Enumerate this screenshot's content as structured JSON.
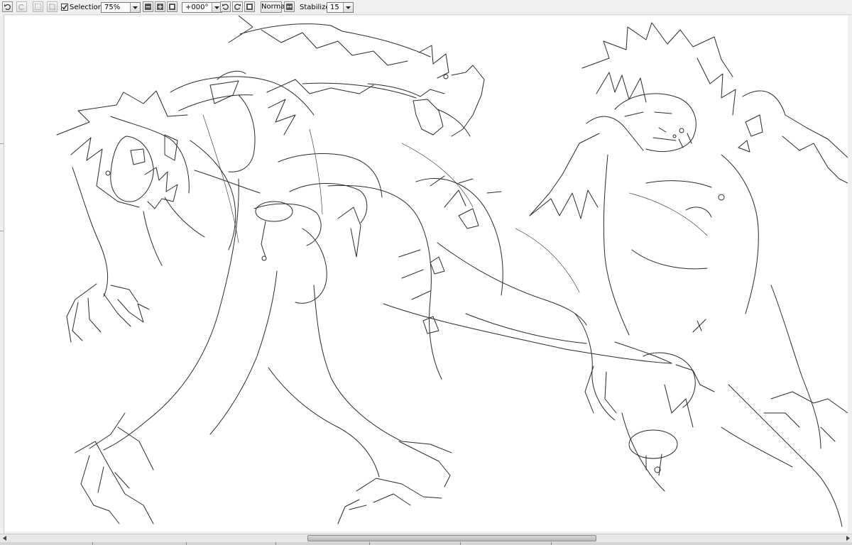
{
  "toolbar": {
    "undo_icon": "undo-icon",
    "redo_icon": "redo-icon",
    "selection_label": "Selection",
    "selection_checked": true,
    "zoom_value": "75%",
    "rotation_value": "+000°",
    "blend_mode_label": "Normal",
    "stabilizer_label": "Stabilizer",
    "stabilizer_value": "15"
  },
  "canvas": {
    "background_color": "#ffffff",
    "content": "sketch-lineart"
  },
  "scrollbar": {
    "left_arrow_icon": "arrow-left-icon",
    "right_arrow_icon": "arrow-right-icon"
  },
  "colors": {
    "chrome": "#f0f0f0",
    "line": "#2a2a2a"
  }
}
